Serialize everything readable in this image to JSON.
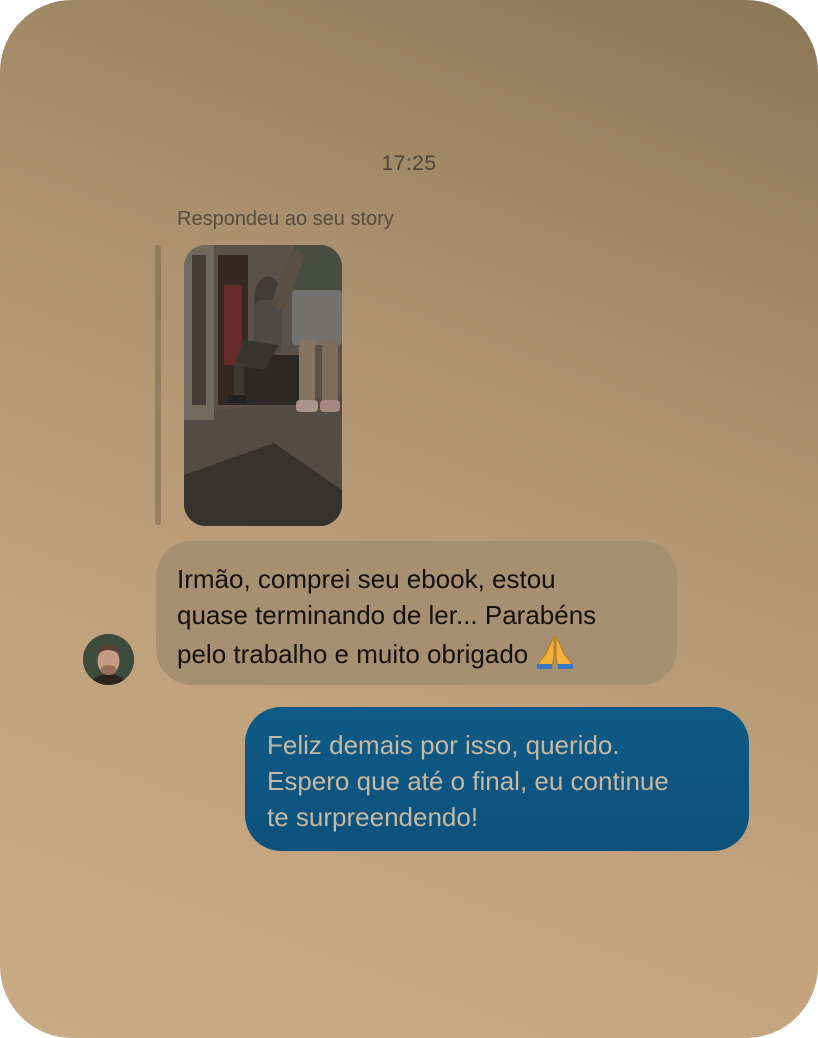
{
  "conversation": {
    "timestamp": "17:25",
    "reply_context": "Respondeu ao seu story",
    "story_thumbnail_icon": "story-photo-gym",
    "messages": [
      {
        "direction": "incoming",
        "text": "Irmão, comprei seu ebook, estou\nquase terminando de ler... Parabéns\npelo trabalho e muito obrigado ",
        "emoji": "🙏"
      },
      {
        "direction": "outgoing",
        "text": "Feliz demais por isso, querido.\nEspero que até o final, eu continue\nte surpreendendo!"
      }
    ]
  },
  "colors": {
    "incoming_bubble": "#a78f72",
    "outgoing_bubble": "#0e5a86",
    "outgoing_text": "#c7b8a2"
  }
}
